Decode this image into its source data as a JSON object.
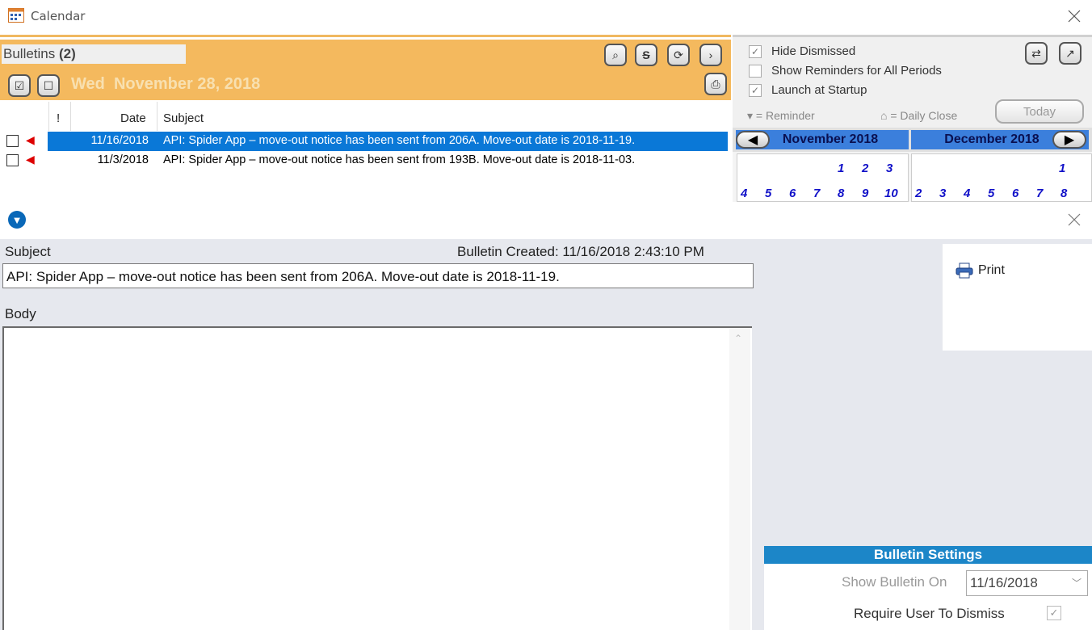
{
  "calendar_window": {
    "title": "Calendar",
    "bulletins": {
      "label": "Bulletins",
      "count": "(2)",
      "date_heading": "Wed  November 28, 2018",
      "columns": {
        "flag": "!",
        "date": "Date",
        "subject": "Subject"
      },
      "rows": [
        {
          "date": "11/16/2018",
          "subject": "API: Spider App – move-out notice has been sent from 206A. Move-out date is 2018-11-19.",
          "selected": true
        },
        {
          "date": "11/3/2018",
          "subject": "API: Spider App – move-out notice has been sent from 193B. Move-out date is 2018-11-03.",
          "selected": false
        }
      ]
    },
    "options": {
      "hide_dismissed": "Hide Dismissed",
      "show_reminders": "Show Reminders for All Periods",
      "launch_startup": "Launch at Startup",
      "legend_reminder": "= Reminder",
      "legend_daily_close": "= Daily Close",
      "today": "Today"
    },
    "months": {
      "left": "November 2018",
      "right": "December 2018",
      "nov_row1": [
        "1",
        "2",
        "3"
      ],
      "nov_row2": [
        "4",
        "5",
        "6",
        "7",
        "8",
        "9",
        "10"
      ],
      "dec_row1": [
        "1"
      ],
      "dec_row2": [
        "2",
        "3",
        "4",
        "5",
        "6",
        "7",
        "8"
      ]
    }
  },
  "detail_window": {
    "subject_label": "Subject",
    "created": "Bulletin Created: 11/16/2018 2:43:10 PM",
    "subject_value": "API: Spider App – move-out notice has been sent from 206A. Move-out date is 2018-11-19.",
    "body_label": "Body",
    "print": "Print",
    "settings": {
      "header": "Bulletin Settings",
      "show_on_label": "Show Bulletin On",
      "show_on_value": "11/16/2018",
      "require_dismiss": "Require User To Dismiss"
    }
  },
  "colors": {
    "header_orange": "#f4b95e",
    "selection_blue": "#0a78d7",
    "settings_blue": "#1c86c8",
    "month_blue": "#3b7fdc"
  }
}
